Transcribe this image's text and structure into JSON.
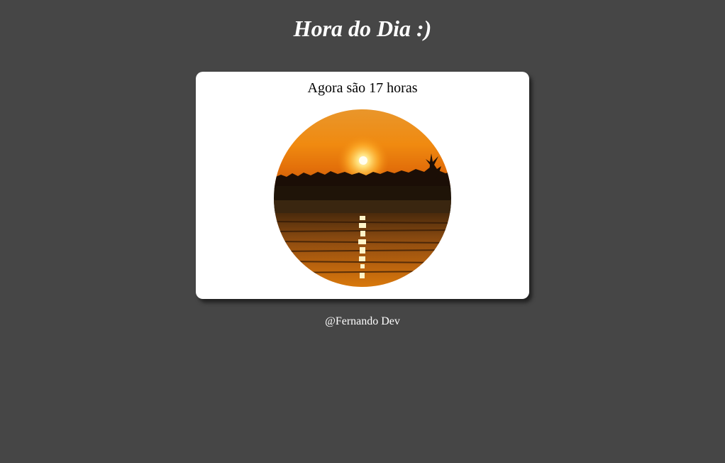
{
  "header": {
    "title": "Hora do Dia :)"
  },
  "card": {
    "message": "Agora são 17 horas",
    "image_icon": "sunset-photo"
  },
  "footer": {
    "credit": "@Fernando Dev"
  },
  "colors": {
    "background": "#464646",
    "card": "#ffffff",
    "text_light": "#ffffff",
    "text_dark": "#000000"
  }
}
